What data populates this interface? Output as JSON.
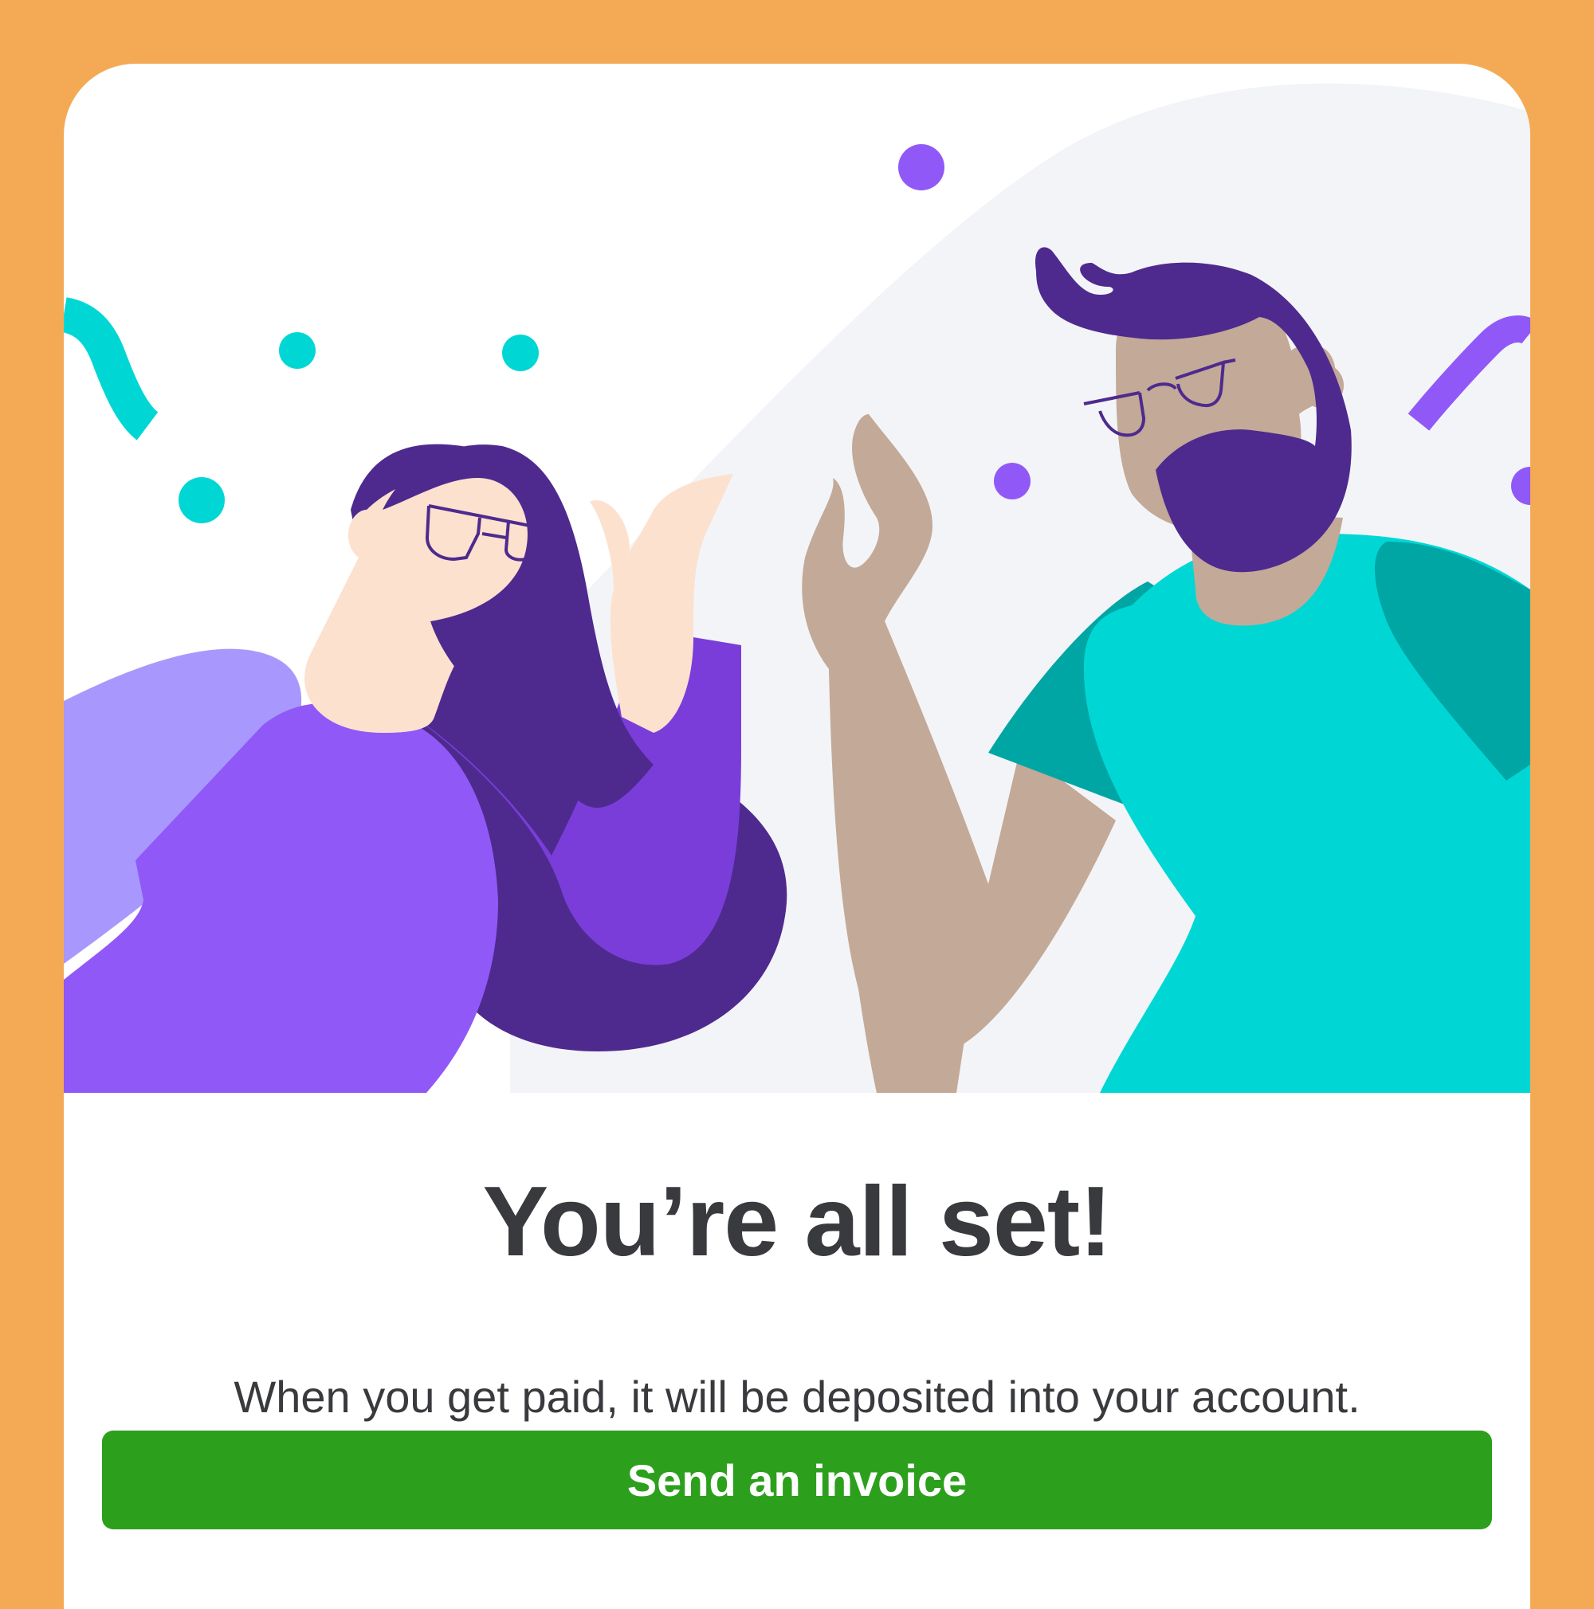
{
  "hero": {
    "illustration": "two-people-celebrating-illustration",
    "colors": {
      "background_wave": "#F3F4F8",
      "purple_dark": "#4E2A8E",
      "purple_mid": "#7A3DD9",
      "purple_bright": "#9158F8",
      "lavender": "#A898FD",
      "teal": "#00D7D5",
      "teal_dark": "#00A6A4",
      "skin_light": "#FCE1CE",
      "skin_tan": "#C3A997"
    }
  },
  "content": {
    "title": "You’re all set!",
    "subtitle": "When you get paid, it will be deposited into your account."
  },
  "actions": {
    "primary_label": "Send an invoice",
    "primary_color": "#2CA01C"
  },
  "frame": {
    "border_color": "#F4AA54"
  }
}
